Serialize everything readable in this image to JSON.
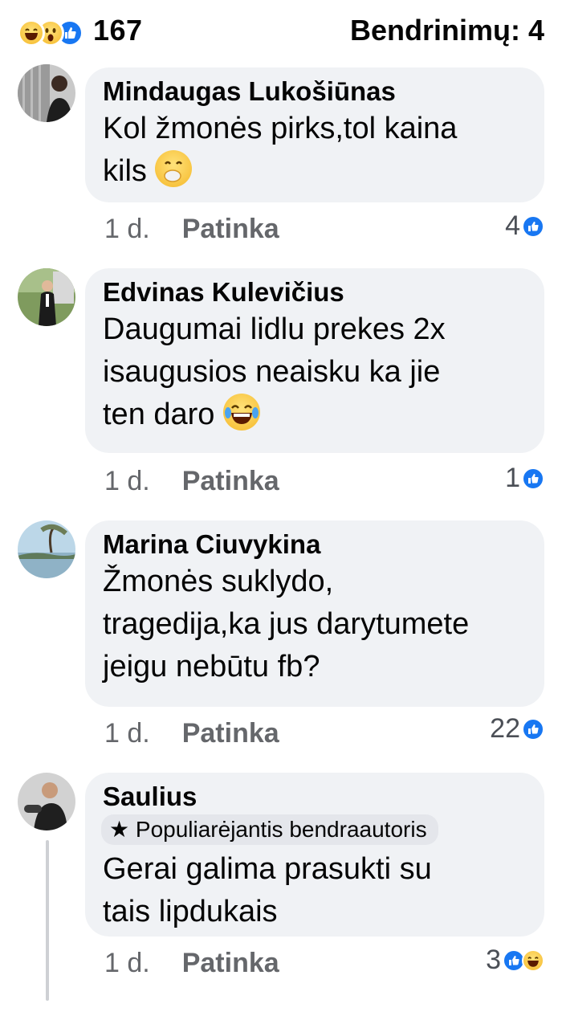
{
  "header": {
    "reaction_count": "167",
    "shares": "Bendrinimų: 4",
    "reaction_icons": [
      "haha-icon",
      "wow-icon",
      "like-icon"
    ]
  },
  "comments": [
    {
      "author": "Mindaugas Lukošiūnas",
      "text_lines": [
        "Kol žmonės pirks,tol kaina",
        "kils"
      ],
      "inline_emoji": "smiling-covering-mouth-emoji",
      "time": "1 d.",
      "like_label": "Patinka",
      "reaction_count": "4"
    },
    {
      "author": "Edvinas Kulevičius",
      "text_lines": [
        "Daugumai lidlu prekes 2x",
        "isaugusios neaisku ka jie",
        "ten daro"
      ],
      "inline_emoji": "tears-of-joy-emoji",
      "time": "1 d.",
      "like_label": "Patinka",
      "reaction_count": "1"
    },
    {
      "author": "Marina Ciuvykina",
      "text_lines": [
        "Žmonės suklydo,",
        "tragedija,ka jus darytumete",
        "jeigu nebūtu fb?"
      ],
      "time": "1 d.",
      "like_label": "Patinka",
      "reaction_count": "22"
    },
    {
      "author": "Saulius",
      "badge": "Populiarėjantis bendraautoris",
      "text_lines": [
        "Gerai galima prasukti su",
        "tais lipdukais"
      ],
      "time": "1 d.",
      "like_label": "Patinka",
      "reaction_count": "3"
    }
  ],
  "colors": {
    "bubble": "#f0f2f5",
    "like_blue": "#1877f2",
    "meta_gray": "#65676b"
  }
}
